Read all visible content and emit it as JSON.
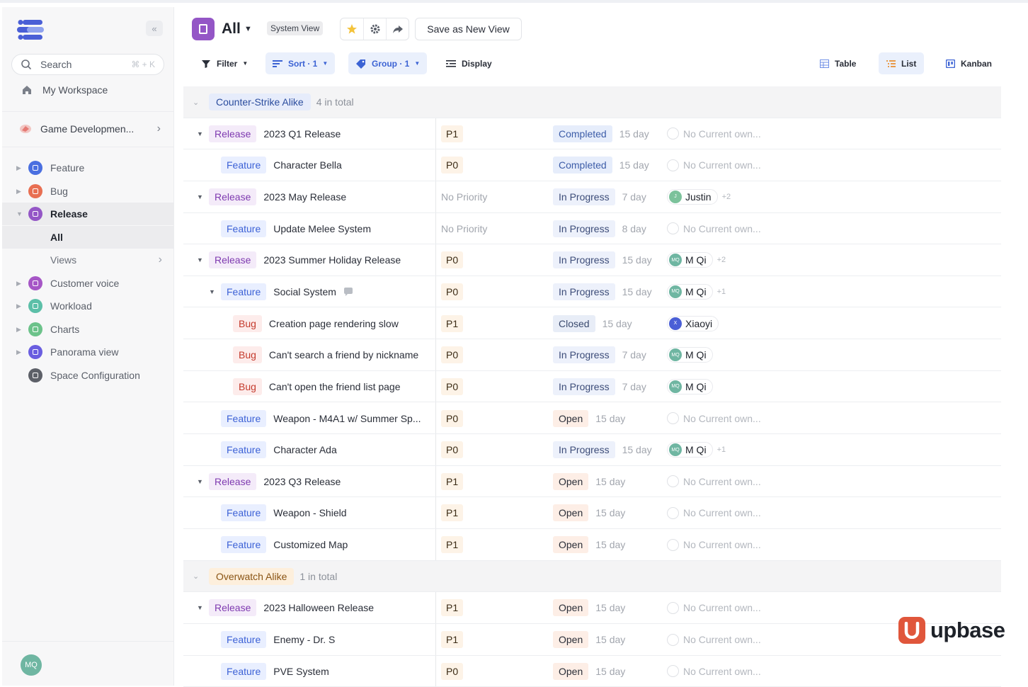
{
  "sidebar": {
    "search_placeholder": "Search",
    "search_shortcut": "⌘ + K",
    "workspace": "My Workspace",
    "project": "Game Developmen...",
    "collapse": "«",
    "nav": [
      {
        "label": "Feature",
        "color": "#4a6fe0",
        "active": false
      },
      {
        "label": "Bug",
        "color": "#e86f52",
        "active": false
      },
      {
        "label": "Release",
        "color": "#9456c6",
        "active": true
      },
      {
        "label": "Customer voice",
        "color": "#a656c6",
        "active": false
      },
      {
        "label": "Workload",
        "color": "#5cbfa8",
        "active": false
      },
      {
        "label": "Charts",
        "color": "#6cc28a",
        "active": false
      },
      {
        "label": "Panorama view",
        "color": "#6a5ee0",
        "active": false
      },
      {
        "label": "Space Configuration",
        "color": "#5d6068",
        "active": false
      }
    ],
    "sub": [
      {
        "label": "All"
      },
      {
        "label": "Views"
      }
    ],
    "user_initials": "MQ"
  },
  "header": {
    "title": "All",
    "badge": "System View",
    "save_view": "Save as New View"
  },
  "toolbar": {
    "filter": "Filter",
    "sort": "Sort · 1",
    "group": "Group · 1",
    "display": "Display",
    "views": [
      "Table",
      "List",
      "Kanban"
    ]
  },
  "colors": {
    "release": "#7e3ab0",
    "feature": "#3d62d6",
    "bug": "#c43a2c",
    "brand": "#e0563b"
  },
  "rows": [
    {
      "kind": "group",
      "name": "Counter-Strike Alike",
      "count": "4 in total",
      "color": "blue"
    },
    {
      "kind": "item",
      "level": 0,
      "caret": true,
      "type": "Release",
      "title": "2023 Q1 Release",
      "priority": "P1",
      "status": "Completed",
      "duration": "15 day",
      "owner": null
    },
    {
      "kind": "item",
      "level": 1,
      "caret": false,
      "type": "Feature",
      "title": "Character Bella",
      "priority": "P0",
      "status": "Completed",
      "duration": "15 day",
      "owner": null
    },
    {
      "kind": "item",
      "level": 0,
      "caret": true,
      "type": "Release",
      "title": "2023 May Release",
      "priority": "No Priority",
      "status": "In Progress",
      "duration": "7 day",
      "owner": {
        "name": "Justin",
        "initials": "J",
        "color": "#7cc29b",
        "more": "+2"
      }
    },
    {
      "kind": "item",
      "level": 1,
      "caret": false,
      "type": "Feature",
      "title": "Update Melee System",
      "priority": "No Priority",
      "status": "In Progress",
      "duration": "8 day",
      "owner": null
    },
    {
      "kind": "item",
      "level": 0,
      "caret": true,
      "type": "Release",
      "title": "2023 Summer Holiday Release",
      "priority": "P0",
      "status": "In Progress",
      "duration": "15 day",
      "owner": {
        "name": "M Qi",
        "initials": "MQ",
        "color": "#6fb6a2",
        "more": "+2"
      }
    },
    {
      "kind": "item",
      "level": 1,
      "caret": true,
      "type": "Feature",
      "title": "Social System",
      "comment": true,
      "priority": "P0",
      "status": "In Progress",
      "duration": "15 day",
      "owner": {
        "name": "M Qi",
        "initials": "MQ",
        "color": "#6fb6a2",
        "more": "+1"
      }
    },
    {
      "kind": "item",
      "level": 2,
      "caret": false,
      "type": "Bug",
      "title": "Creation page rendering slow",
      "priority": "P1",
      "status": "Closed",
      "duration": "15 day",
      "owner": {
        "name": "Xiaoyi",
        "initials": "X",
        "color": "#4a5fd6",
        "more": ""
      }
    },
    {
      "kind": "item",
      "level": 2,
      "caret": false,
      "type": "Bug",
      "title": "Can't search a friend by nickname",
      "priority": "P0",
      "status": "In Progress",
      "duration": "7 day",
      "owner": {
        "name": "M Qi",
        "initials": "MQ",
        "color": "#6fb6a2",
        "more": ""
      }
    },
    {
      "kind": "item",
      "level": 2,
      "caret": false,
      "type": "Bug",
      "title": "Can't open the friend list page",
      "priority": "P0",
      "status": "In Progress",
      "duration": "7 day",
      "owner": {
        "name": "M Qi",
        "initials": "MQ",
        "color": "#6fb6a2",
        "more": ""
      }
    },
    {
      "kind": "item",
      "level": 1,
      "caret": false,
      "type": "Feature",
      "title": "Weapon - M4A1 w/ Summer Sp...",
      "priority": "P0",
      "status": "Open",
      "duration": "15 day",
      "owner": null
    },
    {
      "kind": "item",
      "level": 1,
      "caret": false,
      "type": "Feature",
      "title": "Character Ada",
      "priority": "P0",
      "status": "In Progress",
      "duration": "15 day",
      "owner": {
        "name": "M Qi",
        "initials": "MQ",
        "color": "#6fb6a2",
        "more": "+1"
      }
    },
    {
      "kind": "item",
      "level": 0,
      "caret": true,
      "type": "Release",
      "title": "2023 Q3 Release",
      "priority": "P1",
      "status": "Open",
      "duration": "15 day",
      "owner": null
    },
    {
      "kind": "item",
      "level": 1,
      "caret": false,
      "type": "Feature",
      "title": "Weapon - Shield",
      "priority": "P1",
      "status": "Open",
      "duration": "15 day",
      "owner": null
    },
    {
      "kind": "item",
      "level": 1,
      "caret": false,
      "type": "Feature",
      "title": "Customized Map",
      "priority": "P1",
      "status": "Open",
      "duration": "15 day",
      "owner": null
    },
    {
      "kind": "group",
      "name": "Overwatch Alike",
      "count": "1 in total",
      "color": "orange"
    },
    {
      "kind": "item",
      "level": 0,
      "caret": true,
      "type": "Release",
      "title": "2023 Halloween Release",
      "priority": "P1",
      "status": "Open",
      "duration": "15 day",
      "owner": null
    },
    {
      "kind": "item",
      "level": 1,
      "caret": false,
      "type": "Feature",
      "title": "Enemy - Dr. S",
      "priority": "P1",
      "status": "Open",
      "duration": "15 day",
      "owner": null
    },
    {
      "kind": "item",
      "level": 1,
      "caret": false,
      "type": "Feature",
      "title": "PVE System",
      "priority": "P0",
      "status": "Open",
      "duration": "15 day",
      "owner": null
    }
  ],
  "no_owner_text": "No Current own...",
  "brand": {
    "name": "upbase"
  }
}
